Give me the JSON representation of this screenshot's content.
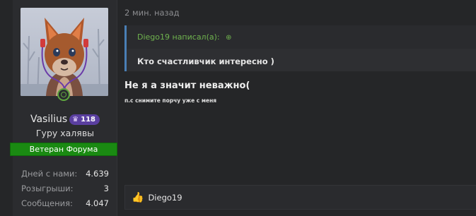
{
  "user": {
    "name": "Vasilius",
    "level": "118",
    "title": "Гуру халявы",
    "rank_badge": "Ветеран Форума",
    "stats": [
      {
        "label": "Дней с нами:",
        "value": "4.639"
      },
      {
        "label": "Розыгрыши:",
        "value": "3"
      },
      {
        "label": "Сообщения:",
        "value": "4.047"
      }
    ]
  },
  "post": {
    "time": "2 мин. назад",
    "quote": {
      "author_line": "Diego19 написал(а):",
      "text": "Кто счастливчик интересно )"
    },
    "message": "Не я а значит неважно(",
    "note": "п.с снимите порчу уже с меня",
    "reaction_user": "Diego19"
  },
  "icons": {
    "online": "online-indicator-icon",
    "crown": "crown-icon",
    "quote_jump": "arrow-up-circle-icon",
    "like": "thumbs-up-icon"
  },
  "colors": {
    "accent_green": "#1a8a12",
    "level_purple": "#5a3fa0",
    "quote_border": "#4a7fb5"
  }
}
